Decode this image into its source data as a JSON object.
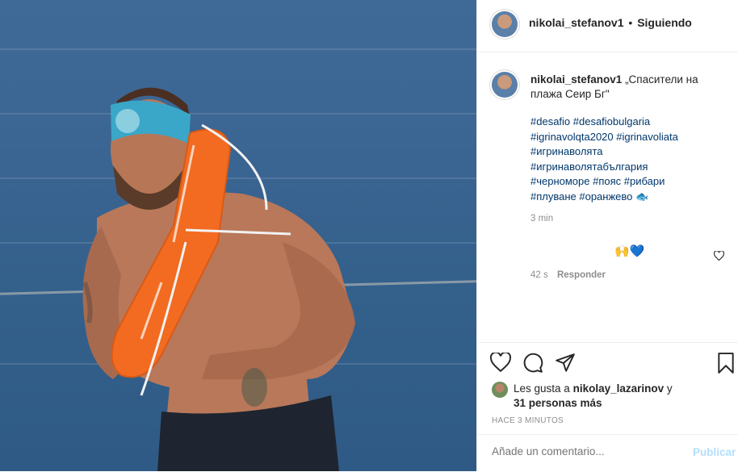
{
  "photo": {
    "description_icon": "lifeguard-photo"
  },
  "header": {
    "username": "nikolai_stefanov1",
    "separator": "•",
    "follow_status": "Siguiendo"
  },
  "caption": {
    "username": "nikolai_stefanov1",
    "text_line1": "„Спасители на",
    "text_line2": "плажа Сеир Бг\"",
    "hashtag_lines": [
      "#desafio #desafiobulgaria",
      "#igrinavolqta2020 #igrinavoliata",
      "#игринаволята",
      "#игринаволятабългария",
      "#черноморе #пояс #рибари",
      "#плуване #оранжево 🐟"
    ],
    "time": "3 min"
  },
  "comment": {
    "emoji": "🙌💙",
    "time": "42 s",
    "reply_label": "Responder"
  },
  "likes": {
    "prefix": "Les gusta a",
    "liker": "nikolay_lazarinov",
    "and": "y",
    "count_text": "31 personas más"
  },
  "post_time": "HACE 3 MINUTOS",
  "comment_input": {
    "placeholder": "Añade un comentario...",
    "publish_label": "Publicar"
  },
  "colors": {
    "link": "#00376b",
    "publish_disabled": "#b2dffc",
    "muted": "#8e8e8e",
    "buoy": "#f26b21"
  }
}
